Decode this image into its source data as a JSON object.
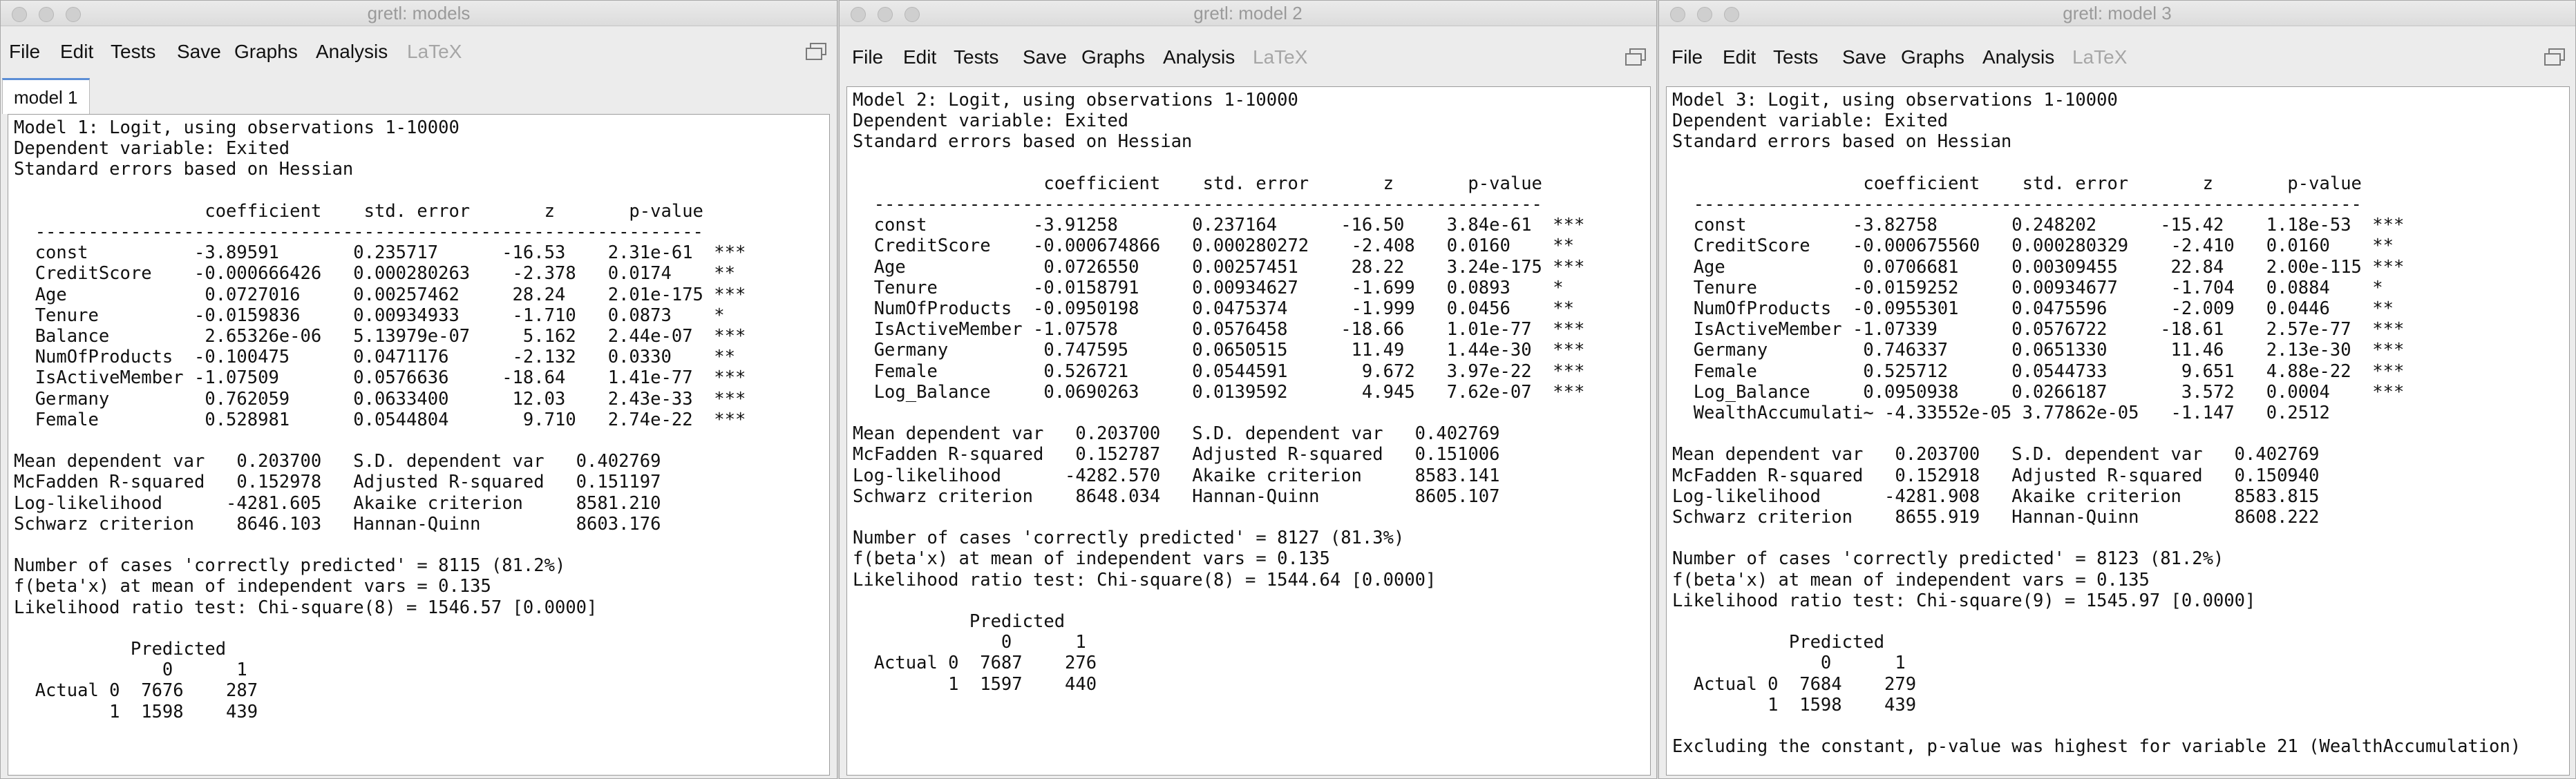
{
  "windows": [
    {
      "title": "gretl: models",
      "menu": [
        "File",
        "Edit",
        "Tests",
        "Save",
        "Graphs",
        "Analysis",
        "LaTeX"
      ],
      "tab": "model 1",
      "output": "Model 1: Logit, using observations 1-10000\nDependent variable: Exited\nStandard errors based on Hessian\n\n                  coefficient    std. error       z       p-value \n  ---------------------------------------------------------------\n  const          -3.89591       0.235717      -16.53    2.31e-61  ***\n  CreditScore    -0.000666426   0.000280263    -2.378   0.0174    **\n  Age             0.0727016     0.00257462     28.24    2.01e-175 ***\n  Tenure         -0.0159836     0.00934933     -1.710   0.0873    *\n  Balance         2.65326e-06   5.13979e-07     5.162   2.44e-07  ***\n  NumOfProducts  -0.100475      0.0471176      -2.132   0.0330    **\n  IsActiveMember -1.07509       0.0576636     -18.64    1.41e-77  ***\n  Germany         0.762059      0.0633400      12.03    2.43e-33  ***\n  Female          0.528981      0.0544804       9.710   2.74e-22  ***\n\nMean dependent var   0.203700   S.D. dependent var   0.402769\nMcFadden R-squared   0.152978   Adjusted R-squared   0.151197\nLog-likelihood      -4281.605   Akaike criterion     8581.210\nSchwarz criterion    8646.103   Hannan-Quinn         8603.176\n\nNumber of cases 'correctly predicted' = 8115 (81.2%)\nf(beta'x) at mean of independent vars = 0.135\nLikelihood ratio test: Chi-square(8) = 1546.57 [0.0000]\n\n           Predicted\n              0      1\n  Actual 0  7676    287\n         1  1598    439"
    },
    {
      "title": "gretl: model 2",
      "menu": [
        "File",
        "Edit",
        "Tests",
        "Save",
        "Graphs",
        "Analysis",
        "LaTeX"
      ],
      "output": "Model 2: Logit, using observations 1-10000\nDependent variable: Exited\nStandard errors based on Hessian\n\n                  coefficient    std. error       z       p-value \n  ---------------------------------------------------------------\n  const          -3.91258       0.237164      -16.50    3.84e-61  ***\n  CreditScore    -0.000674866   0.000280272    -2.408   0.0160    **\n  Age             0.0726550     0.00257451     28.22    3.24e-175 ***\n  Tenure         -0.0158791     0.00934627     -1.699   0.0893    *\n  NumOfProducts  -0.0950198     0.0475374      -1.999   0.0456    **\n  IsActiveMember -1.07578       0.0576458     -18.66    1.01e-77  ***\n  Germany         0.747595      0.0650515      11.49    1.44e-30  ***\n  Female          0.526721      0.0544591       9.672   3.97e-22  ***\n  Log_Balance     0.0690263     0.0139592       4.945   7.62e-07  ***\n\nMean dependent var   0.203700   S.D. dependent var   0.402769\nMcFadden R-squared   0.152787   Adjusted R-squared   0.151006\nLog-likelihood      -4282.570   Akaike criterion     8583.141\nSchwarz criterion    8648.034   Hannan-Quinn         8605.107\n\nNumber of cases 'correctly predicted' = 8127 (81.3%)\nf(beta'x) at mean of independent vars = 0.135\nLikelihood ratio test: Chi-square(8) = 1544.64 [0.0000]\n\n           Predicted\n              0      1\n  Actual 0  7687    276\n         1  1597    440"
    },
    {
      "title": "gretl: model 3",
      "menu": [
        "File",
        "Edit",
        "Tests",
        "Save",
        "Graphs",
        "Analysis",
        "LaTeX"
      ],
      "output": "Model 3: Logit, using observations 1-10000\nDependent variable: Exited\nStandard errors based on Hessian\n\n                  coefficient    std. error       z       p-value \n  ---------------------------------------------------------------\n  const          -3.82758       0.248202      -15.42    1.18e-53  ***\n  CreditScore    -0.000675560   0.000280329    -2.410   0.0160    **\n  Age             0.0706681     0.00309455     22.84    2.00e-115 ***\n  Tenure         -0.0159252     0.00934677     -1.704   0.0884    *\n  NumOfProducts  -0.0955301     0.0475596      -2.009   0.0446    **\n  IsActiveMember -1.07339       0.0576722     -18.61    2.57e-77  ***\n  Germany         0.746337      0.0651330      11.46    2.13e-30  ***\n  Female          0.525712      0.0544733       9.651   4.88e-22  ***\n  Log_Balance     0.0950938     0.0266187       3.572   0.0004    ***\n  WealthAccumulati~ -4.33552e-05 3.77862e-05   -1.147   0.2512\n\nMean dependent var   0.203700   S.D. dependent var   0.402769\nMcFadden R-squared   0.152918   Adjusted R-squared   0.150940\nLog-likelihood      -4281.908   Akaike criterion     8583.815\nSchwarz criterion    8655.919   Hannan-Quinn         8608.222\n\nNumber of cases 'correctly predicted' = 8123 (81.2%)\nf(beta'x) at mean of independent vars = 0.135\nLikelihood ratio test: Chi-square(9) = 1545.97 [0.0000]\n\n           Predicted\n              0      1\n  Actual 0  7684    279\n         1  1598    439\n\nExcluding the constant, p-value was highest for variable 21 (WealthAccumulation)"
    }
  ]
}
